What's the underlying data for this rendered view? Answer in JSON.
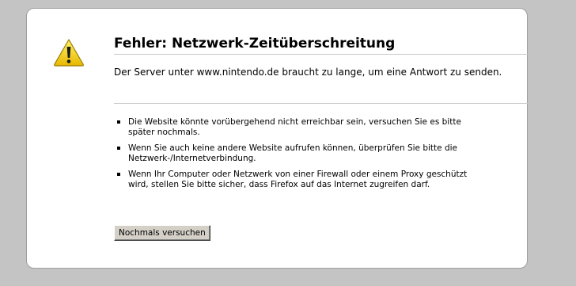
{
  "error": {
    "icon": "warning-icon",
    "title": "Fehler: Netzwerk-Zeitüberschreitung",
    "description": "Der Server unter www.nintendo.de braucht zu lange, um eine Antwort zu senden.",
    "reasons": [
      "Die Website könnte vorübergehend nicht erreichbar sein, versuchen Sie es bitte später nochmals.",
      "Wenn Sie auch keine andere Website aufrufen können, überprüfen Sie bitte die Netzwerk-/Internetverbindung.",
      "Wenn Ihr Computer oder Netzwerk von einer Firewall oder einem Proxy geschützt wird, stellen Sie bitte sicher, dass Firefox auf das Internet zugreifen darf."
    ],
    "retry_label": "Nochmals versuchen"
  },
  "colors": {
    "background": "#c4c4c4",
    "card": "#ffffff",
    "warning_yellow": "#f2d200"
  }
}
